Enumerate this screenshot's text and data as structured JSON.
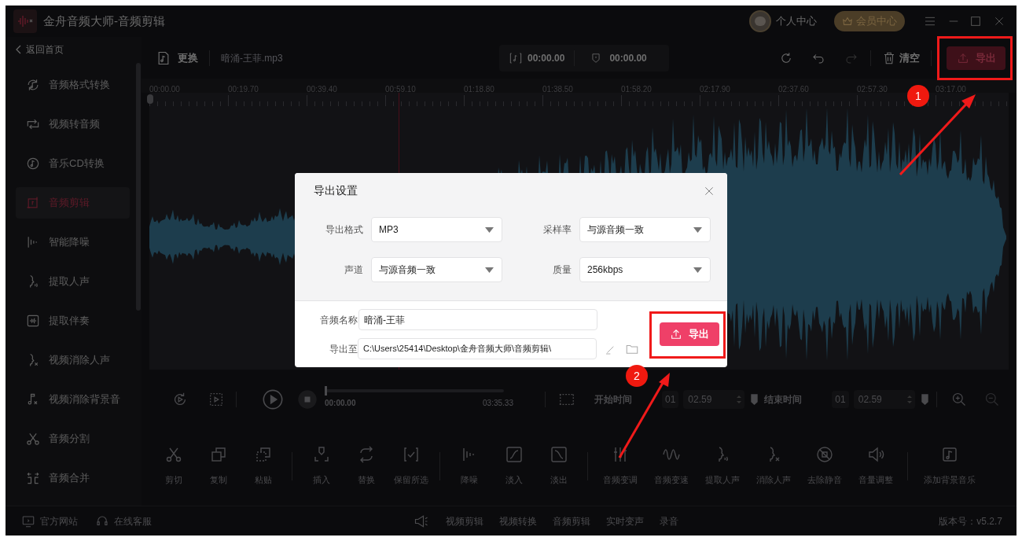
{
  "window": {
    "title": "金舟音频大师-音频剪辑"
  },
  "header": {
    "user_label": "个人中心",
    "vip_label": "会员中心"
  },
  "sidebar": {
    "back": "返回首页",
    "items": [
      {
        "label": "音频格式转换",
        "kind": "convert",
        "selected": false
      },
      {
        "label": "视频转音频",
        "kind": "v2a",
        "selected": false
      },
      {
        "label": "音乐CD转换",
        "kind": "cd",
        "selected": false
      },
      {
        "label": "音频剪辑",
        "kind": "edit",
        "selected": true
      },
      {
        "label": "智能降噪",
        "kind": "denoise",
        "selected": false
      },
      {
        "label": "提取人声",
        "kind": "voice",
        "selected": false
      },
      {
        "label": "提取伴奏",
        "kind": "accomp",
        "selected": false
      },
      {
        "label": "视频消除人声",
        "kind": "novoice",
        "selected": false
      },
      {
        "label": "视频消除背景音",
        "kind": "nobg",
        "selected": false
      },
      {
        "label": "音频分割",
        "kind": "scissors",
        "selected": false
      },
      {
        "label": "音频合并",
        "kind": "merge",
        "selected": false
      }
    ]
  },
  "toolbar": {
    "replace": "更换",
    "file_name": "暗涌-王菲.mp3",
    "start_time": "00:00.00",
    "end_time": "00:00.00",
    "clear": "清空",
    "export": "导出"
  },
  "ruler": [
    "00:00.00",
    "00:19.70",
    "00:39.40",
    "00:59.10",
    "01:18.80",
    "01:38.50",
    "01:58.20",
    "02:17.90",
    "02:37.60",
    "02:57.30",
    "03:17.00"
  ],
  "player": {
    "position": "00:00.00",
    "duration": "03:35.33",
    "level": 0,
    "start_label": "开始时间",
    "start_minutes": "01",
    "start_seconds": "02.59",
    "end_label": "结束时间",
    "end_minutes": "01",
    "end_seconds": "02.59"
  },
  "tool_groups": [
    {
      "tools": [
        {
          "label": "剪切",
          "kind": "scissors"
        },
        {
          "label": "复制",
          "kind": "copy"
        },
        {
          "label": "粘贴",
          "kind": "paste"
        }
      ]
    },
    {
      "tools": [
        {
          "label": "插入",
          "kind": "insert"
        },
        {
          "label": "替换",
          "kind": "replace"
        },
        {
          "label": "保留所选",
          "kind": "keep"
        }
      ]
    },
    {
      "tools": [
        {
          "label": "降噪",
          "kind": "denoise"
        },
        {
          "label": "淡入",
          "kind": "fadein"
        },
        {
          "label": "淡出",
          "kind": "fadeout"
        }
      ]
    },
    {
      "tools": [
        {
          "label": "音频变调",
          "kind": "pitch"
        },
        {
          "label": "音频变速",
          "kind": "speed"
        },
        {
          "label": "提取人声",
          "kind": "voice"
        },
        {
          "label": "消除人声",
          "kind": "novoice"
        },
        {
          "label": "去除静音",
          "kind": "silence"
        },
        {
          "label": "音量调整",
          "kind": "volume"
        }
      ]
    },
    {
      "tools": [
        {
          "label": "添加背景音乐",
          "kind": "music"
        }
      ]
    }
  ],
  "dialog": {
    "title": "导出设置",
    "fields": [
      {
        "label": "导出格式",
        "value": "MP3"
      },
      {
        "label": "采样率",
        "value": "与源音频一致"
      },
      {
        "label": "声道",
        "value": "与源音频一致"
      },
      {
        "label": "质量",
        "value": "256kbps"
      }
    ],
    "name_label": "音频名称",
    "name": "暗涌-王菲",
    "path_label": "导出至",
    "path": "C:\\Users\\25414\\Desktop\\金舟音频大师\\音频剪辑\\",
    "button": "导出"
  },
  "status_bar": {
    "links": [
      {
        "label": "官方网站",
        "kind": "monitor"
      },
      {
        "label": "在线客服",
        "kind": "headset"
      }
    ],
    "products": [
      "视频剪辑",
      "视频转换",
      "音频剪辑",
      "实时变声",
      "录音"
    ],
    "version": "版本号：v5.2.7"
  },
  "annotations": [
    {
      "number": "1"
    },
    {
      "number": "2"
    }
  ]
}
